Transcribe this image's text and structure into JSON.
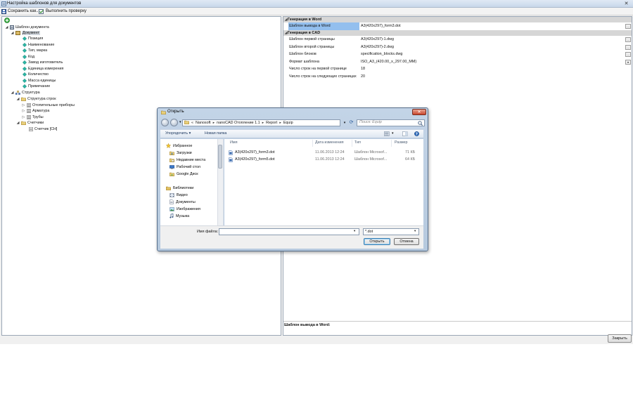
{
  "window": {
    "title": "Настройка шаблонов для документов",
    "close_glyph": "✕"
  },
  "toolbar": {
    "save_label": "Сохранить как...",
    "check_label": "Выполнить проверку"
  },
  "tree": {
    "root": "Шаблон документа",
    "document": "Документ",
    "fields": [
      "Позиция",
      "Наименование",
      "Тип, марка",
      "Код",
      "Завод изготовитель",
      "Единица измерения",
      "Количество",
      "Масса единицы",
      "Примечание"
    ],
    "structure": "Структура",
    "row_structure": "Структура строк",
    "row_items": [
      "Отопительные приборы",
      "Арматура",
      "Трубы"
    ],
    "counters": "Счетчики",
    "counter_item": "Счетчик [СН]"
  },
  "properties": {
    "word_category": "Генерация в Word",
    "word_rows": [
      {
        "name": "Шаблон вывода в Word",
        "value": "А3(420х297)_form3.dot"
      }
    ],
    "cad_category": "Генерация в CAD",
    "cad_rows": [
      {
        "name": "Шаблон первой страницы",
        "value": "А3(420х297)-1.dwg"
      },
      {
        "name": "Шаблон второй страницы",
        "value": "А3(420х297)-2.dwg"
      },
      {
        "name": "Шаблон блоков",
        "value": "specification_blocks.dwg"
      },
      {
        "name": "Формат шаблона",
        "value": "ISO_A3_(420.00_x_297.00_MM)"
      },
      {
        "name": "Число строк на первой странице",
        "value": "18"
      },
      {
        "name": "Число строк на следующих страницах",
        "value": "20"
      }
    ],
    "ellipsis": "...",
    "description_title": "Шаблон вывода в Word:"
  },
  "close_button_label": "Закрыть",
  "dialog": {
    "title": "Открыть",
    "close_glyph": "✕",
    "address": {
      "overflow": "«",
      "crumbs": [
        "Nanosoft",
        "nanoCAD Отопление 1.1",
        "Report",
        "Equip"
      ],
      "separator": "▸"
    },
    "search_placeholder": "Поиск: Equip",
    "organize_label": "Упорядочить ▾",
    "new_folder_label": "Новая папка",
    "nav": {
      "favorites": "Избранное",
      "favorite_items": [
        "Загрузки",
        "Недавние места",
        "Рабочий стол",
        "Google Диск"
      ],
      "libraries": "Библиотеки",
      "library_items": [
        "Видео",
        "Документы",
        "Изображения",
        "Музыка"
      ]
    },
    "columns": [
      "Имя",
      "Дата изменения",
      "Тип",
      "Размер"
    ],
    "files": [
      {
        "name": "А3(420х297)_form3.dot",
        "date": "11.06.2013 12:24",
        "type": "Шаблон Microsof...",
        "size": "71 КБ"
      },
      {
        "name": "А3(420х297)_form5.dot",
        "date": "11.06.2013 12:24",
        "type": "Шаблон Microsof...",
        "size": "64 КБ"
      }
    ],
    "filename_label": "Имя файла:",
    "filename_value": "",
    "filter_value": "*.dot",
    "open_label": "Открыть",
    "cancel_label": "Отмена"
  },
  "colors": {
    "selection": "#93bfee",
    "tree_selection": "#cfd5dc",
    "category_band": "#d6d6d6",
    "dialog_frame": "#c3d4e7",
    "dialog_close": "#c9452d",
    "link_text": "#1e3960"
  },
  "icons": [
    "save-icon",
    "check-icon",
    "add-icon",
    "document-tree-icon",
    "document-node-icon",
    "field-icon",
    "structure-icon",
    "folder-icon",
    "list-icon",
    "counter-icon",
    "star-icon",
    "folder-icon",
    "library-icon",
    "dot-file-icon",
    "search-icon",
    "refresh-icon",
    "view-icon",
    "help-icon"
  ]
}
